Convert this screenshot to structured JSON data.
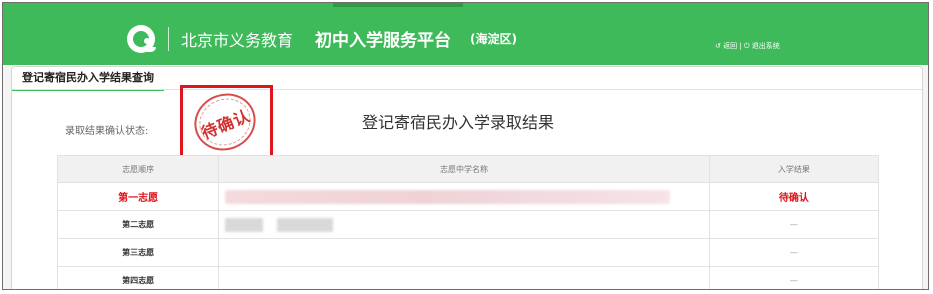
{
  "header": {
    "title_prefix": "北京市义务教育",
    "title_strong": "初中入学服务平台",
    "title_district": "(海淀区)",
    "links": [
      "返回",
      "退出系统"
    ],
    "link_separator": "|",
    "colors": {
      "brand": "#3fba5a",
      "accent_red": "#e0141c"
    },
    "icons": {
      "logo": "platform-logo-icon",
      "back": "back-arrow-icon",
      "logout": "power-icon"
    }
  },
  "panel": {
    "tab_label": "登记寄宿民办入学结果查询"
  },
  "status": {
    "label": "录取结果确认状态:",
    "stamp_text": "待确认"
  },
  "result": {
    "title": "登记寄宿民办入学录取结果",
    "columns": [
      "志愿顺序",
      "志愿中学名称",
      "入学结果"
    ],
    "rows": [
      {
        "order": "第一志愿",
        "school": "",
        "result": "待确认"
      },
      {
        "order": "第二志愿",
        "school": "",
        "result": "—"
      },
      {
        "order": "第三志愿",
        "school": "",
        "result": "—"
      },
      {
        "order": "第四志愿",
        "school": "",
        "result": "—"
      }
    ]
  }
}
